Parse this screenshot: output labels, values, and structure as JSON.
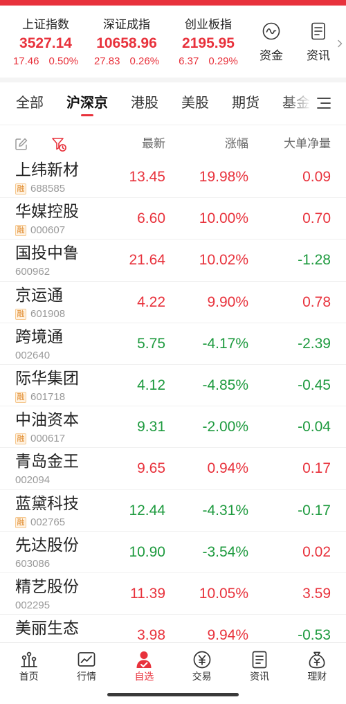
{
  "indices": [
    {
      "name": "上证指数",
      "value": "3527.14",
      "change": "17.46",
      "pct": "0.50%"
    },
    {
      "name": "深证成指",
      "value": "10658.96",
      "change": "27.83",
      "pct": "0.26%"
    },
    {
      "name": "创业板指",
      "value": "2195.95",
      "change": "6.37",
      "pct": "0.29%"
    }
  ],
  "quick_links": [
    {
      "label": "资金",
      "icon": "fund-flow-icon"
    },
    {
      "label": "资讯",
      "icon": "news-icon"
    }
  ],
  "tabs": [
    {
      "label": "全部"
    },
    {
      "label": "沪深京",
      "selected": true
    },
    {
      "label": "港股"
    },
    {
      "label": "美股"
    },
    {
      "label": "期货"
    },
    {
      "label": "基金"
    }
  ],
  "list_header": {
    "latest": "最新",
    "change_pct": "涨幅",
    "net_volume": "大单净量"
  },
  "stocks": [
    {
      "name": "上纬新材",
      "badge": "融",
      "code": "688585",
      "price": "13.45",
      "pct": "19.98%",
      "net": "0.09"
    },
    {
      "name": "华媒控股",
      "badge": "融",
      "code": "000607",
      "price": "6.60",
      "pct": "10.00%",
      "net": "0.70"
    },
    {
      "name": "国投中鲁",
      "code": "600962",
      "price": "21.64",
      "pct": "10.02%",
      "net": "-1.28"
    },
    {
      "name": "京运通",
      "badge": "融",
      "code": "601908",
      "price": "4.22",
      "pct": "9.90%",
      "net": "0.78"
    },
    {
      "name": "跨境通",
      "code": "002640",
      "price": "5.75",
      "pct": "-4.17%",
      "net": "-2.39"
    },
    {
      "name": "际华集团",
      "badge": "融",
      "code": "601718",
      "price": "4.12",
      "pct": "-4.85%",
      "net": "-0.45"
    },
    {
      "name": "中油资本",
      "badge": "融",
      "code": "000617",
      "price": "9.31",
      "pct": "-2.00%",
      "net": "-0.04"
    },
    {
      "name": "青岛金王",
      "code": "002094",
      "price": "9.65",
      "pct": "0.94%",
      "net": "0.17"
    },
    {
      "name": "蓝黛科技",
      "badge": "融",
      "code": "002765",
      "price": "12.44",
      "pct": "-4.31%",
      "net": "-0.17"
    },
    {
      "name": "先达股份",
      "code": "603086",
      "price": "10.90",
      "pct": "-3.54%",
      "net": "0.02"
    },
    {
      "name": "精艺股份",
      "code": "002295",
      "price": "11.39",
      "pct": "10.05%",
      "net": "3.59"
    },
    {
      "name": "美丽生态",
      "price": "3.98",
      "pct": "9.94%",
      "net": "-0.53"
    }
  ],
  "bottom_nav": [
    {
      "label": "首页",
      "icon": "home-bars-icon"
    },
    {
      "label": "行情",
      "icon": "market-chart-icon"
    },
    {
      "label": "自选",
      "icon": "watchlist-icon",
      "selected": true
    },
    {
      "label": "交易",
      "icon": "trade-yuan-icon"
    },
    {
      "label": "资讯",
      "icon": "news-icon"
    },
    {
      "label": "理财",
      "icon": "wealth-bag-icon"
    }
  ],
  "colors": {
    "up": "#e8323c",
    "down": "#1d9a3e",
    "accent": "#e8323c",
    "nav_default": "#333333"
  }
}
